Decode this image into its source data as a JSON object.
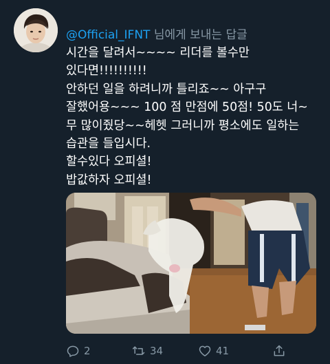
{
  "reply": {
    "handle": "@Official_IFNT",
    "suffix": " 님에게 보내는 답글"
  },
  "tweet": {
    "text": "시간을 달려서~~~~ 리더를 볼수만\n있다면!!!!!!!!!!\n안하던 일을 하려니까 틀리죠~~ 아구구\n잘했어용~~~ 100 점 만점에 50점! 50도 너~\n무 많이줬당~~헤헷 그러니까 평소에도 일하는\n습관을 들입시다.\n할수있다 오피셜!\n밥값하자 오피셜!"
  },
  "actions": {
    "replies": "2",
    "retweets": "34",
    "likes": "41"
  },
  "icons": {
    "reply": "reply-icon",
    "retweet": "retweet-icon",
    "like": "heart-icon",
    "share": "share-icon"
  },
  "colors": {
    "background": "#15202b",
    "accent": "#1da1f2",
    "muted": "#8899a6"
  }
}
